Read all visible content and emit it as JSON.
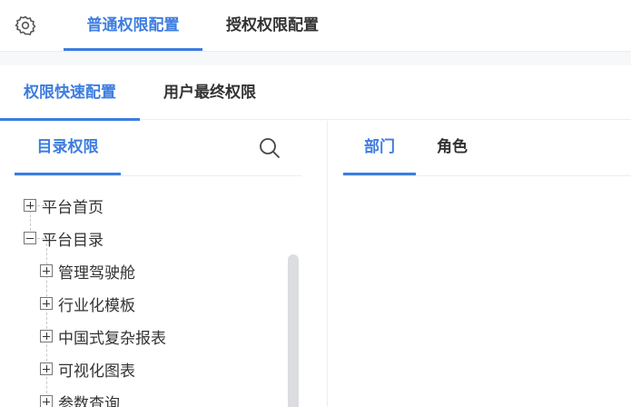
{
  "top_tabs": [
    {
      "label": "普通权限配置",
      "active": true
    },
    {
      "label": "授权权限配置",
      "active": false
    }
  ],
  "sub_tabs": [
    {
      "label": "权限快速配置",
      "active": true
    },
    {
      "label": "用户最终权限",
      "active": false
    }
  ],
  "left_panel": {
    "tab_label": "目录权限"
  },
  "tree": {
    "items": [
      {
        "label": "平台首页",
        "expanded": false
      },
      {
        "label": "平台目录",
        "expanded": true
      },
      {
        "label": "管理驾驶舱",
        "expanded": false
      },
      {
        "label": "行业化模板",
        "expanded": false
      },
      {
        "label": "中国式复杂报表",
        "expanded": false
      },
      {
        "label": "可视化图表",
        "expanded": false
      },
      {
        "label": "参数查询",
        "expanded": false
      }
    ]
  },
  "right_panel": {
    "tabs": [
      {
        "label": "部门",
        "active": true
      },
      {
        "label": "角色",
        "active": false
      }
    ]
  },
  "colors": {
    "accent": "#3c7de0",
    "text": "#333333",
    "background": "#f7f8fa"
  },
  "icons": [
    "gear-icon",
    "search-icon",
    "plus-toggle-icon",
    "minus-toggle-icon"
  ]
}
